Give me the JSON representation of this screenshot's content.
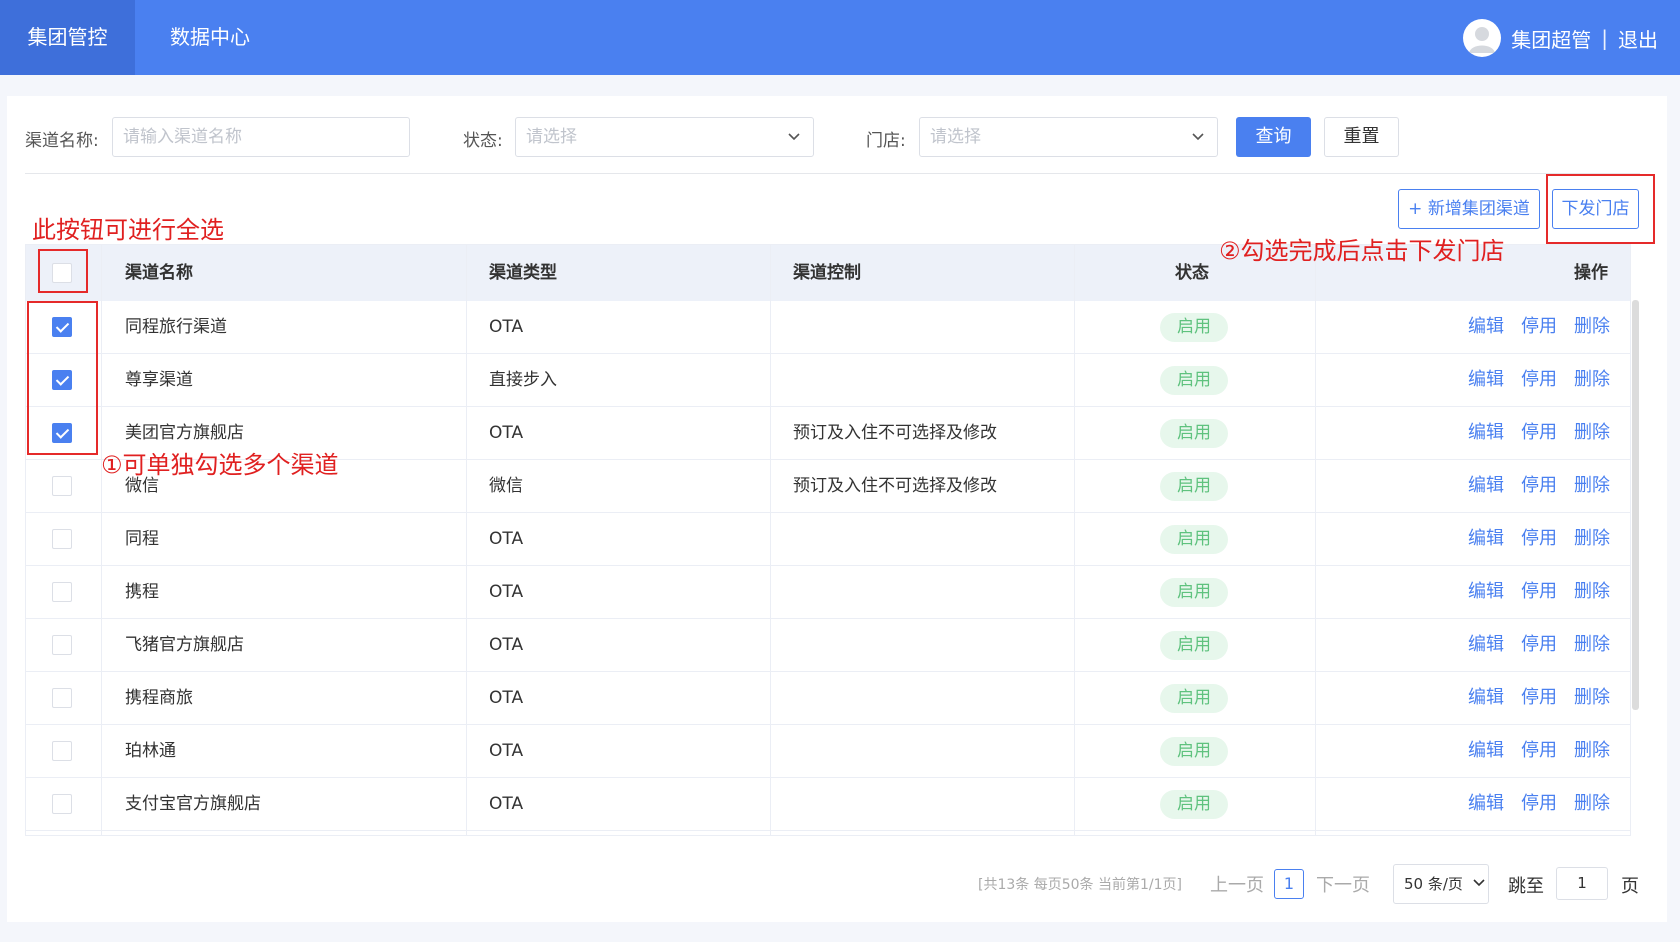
{
  "topbar": {
    "tabs": [
      {
        "label": "集团管控",
        "active": true
      },
      {
        "label": "数据中心",
        "active": false
      }
    ],
    "user_name": "集团超管",
    "separator": "|",
    "logout_label": "退出"
  },
  "filters": {
    "channel_name_label": "渠道名称:",
    "channel_name_placeholder": "请输入渠道名称",
    "status_label": "状态:",
    "status_placeholder": "请选择",
    "store_label": "门店:",
    "store_placeholder": "请选择",
    "query_label": "查询",
    "reset_label": "重置"
  },
  "actions": {
    "add_channel_label": "+ 新增集团渠道",
    "dispatch_label": "下发门店"
  },
  "annotations": {
    "select_all_note": "此按钮可进行全选",
    "dispatch_note": "②勾选完成后点击下发门店",
    "multi_select_note": "①可单独勾选多个渠道"
  },
  "table": {
    "columns": [
      "渠道名称",
      "渠道类型",
      "渠道控制",
      "状态",
      "操作"
    ],
    "op_labels": {
      "edit": "编辑",
      "disable": "停用",
      "delete": "删除"
    },
    "rows": [
      {
        "name": "同程旅行渠道",
        "type": "OTA",
        "control": "",
        "status": "启用",
        "checked": true
      },
      {
        "name": "尊享渠道",
        "type": "直接步入",
        "control": "",
        "status": "启用",
        "checked": true
      },
      {
        "name": "美团官方旗舰店",
        "type": "OTA",
        "control": "预订及入住不可选择及修改",
        "status": "启用",
        "checked": true
      },
      {
        "name": "微信",
        "type": "微信",
        "control": "预订及入住不可选择及修改",
        "status": "启用",
        "checked": false
      },
      {
        "name": "同程",
        "type": "OTA",
        "control": "",
        "status": "启用",
        "checked": false
      },
      {
        "name": "携程",
        "type": "OTA",
        "control": "",
        "status": "启用",
        "checked": false
      },
      {
        "name": "飞猪官方旗舰店",
        "type": "OTA",
        "control": "",
        "status": "启用",
        "checked": false
      },
      {
        "name": "携程商旅",
        "type": "OTA",
        "control": "",
        "status": "启用",
        "checked": false
      },
      {
        "name": "珀林通",
        "type": "OTA",
        "control": "",
        "status": "启用",
        "checked": false
      },
      {
        "name": "支付宝官方旗舰店",
        "type": "OTA",
        "control": "",
        "status": "启用",
        "checked": false
      }
    ]
  },
  "pagination": {
    "info": "[共13条 每页50条 当前第1/1页]",
    "prev_label": "上一页",
    "current_page": "1",
    "next_label": "下一页",
    "page_size": "50 条/页",
    "jump_label": "跳至",
    "jump_value": "1",
    "page_suffix": "页"
  },
  "colors": {
    "primary": "#4a80f0",
    "topbar": "#4a80f0",
    "annotation": "#e02020",
    "status_badge_bg": "#e7f7ec",
    "status_badge_text": "#5fc27e"
  }
}
